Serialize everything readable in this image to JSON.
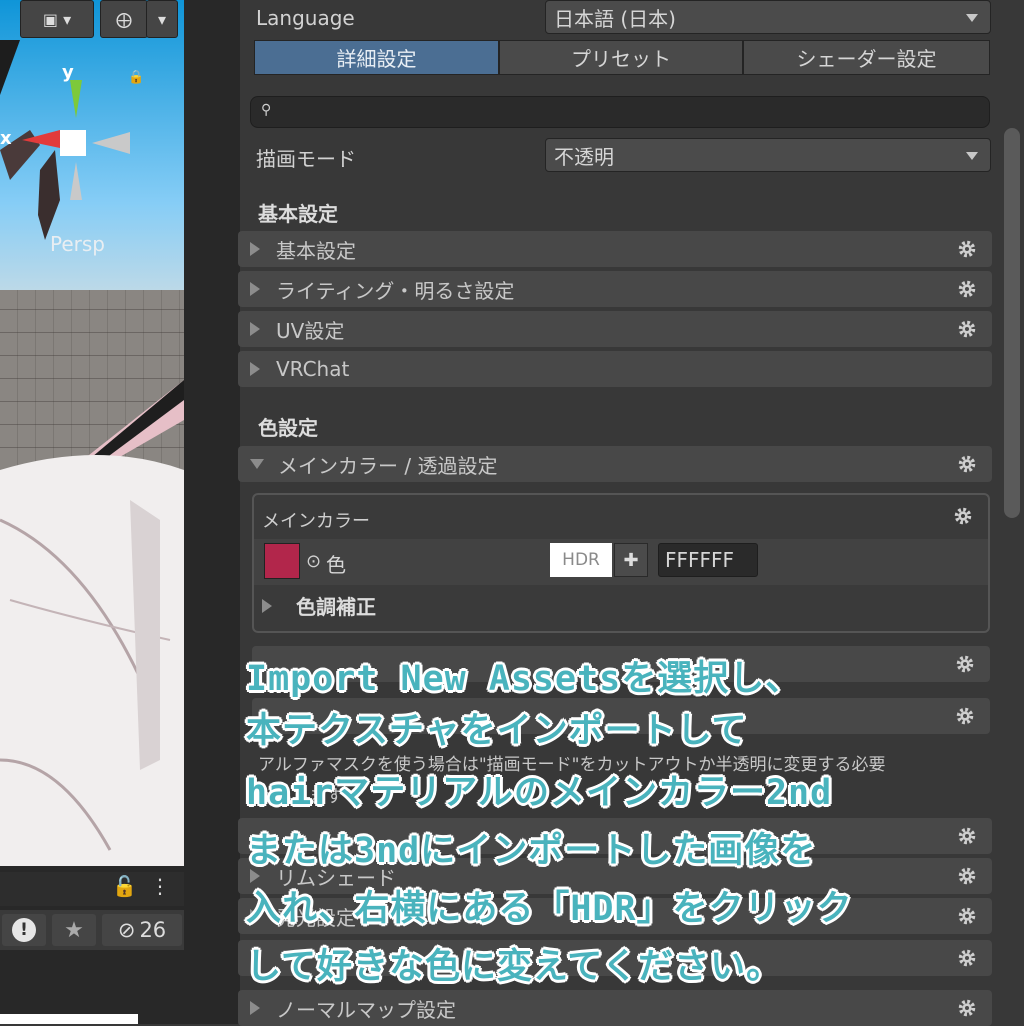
{
  "scene": {
    "gizmo_y": "y",
    "gizmo_x": "x",
    "projection": "Persp",
    "counter": "26"
  },
  "inspector": {
    "language_label": "Language",
    "language_value": "日本語 (日本)",
    "tabs": [
      "詳細設定",
      "プリセット",
      "シェーダー設定"
    ],
    "render_mode_label": "描画モード",
    "render_mode_value": "不透明",
    "basic_section": "基本設定",
    "basic_folds": [
      "基本設定",
      "ライティング・明るさ設定",
      "UV設定",
      "VRChat"
    ],
    "color_section": "色設定",
    "main_color_fold": "メインカラー / 透過設定",
    "main_color_box_title": "メインカラー",
    "color_label": "色",
    "hdr_label": "HDR",
    "hex_value": "FFFFFF",
    "color_adjust_label": "色調補正",
    "partial_help": "アルファマスクを使う場合は\"描画モード\"をカットアウトか半透明に変更する必要",
    "partial_help2": "があります",
    "partial_rim": "リムシェード",
    "partial_light": "発光設定",
    "normal_fold": "ノーマルマップ設定"
  },
  "overlay": {
    "lines": [
      "Import New Assetsを選択し、",
      "本テクスチャをインポートして",
      "hairマテリアルのメインカラー2nd",
      "または3ndにインポートした画像を",
      "入れ、右横にある「HDR」をクリック",
      "して好きな色に変えてください。"
    ]
  },
  "colors": {
    "accent_tab": "#4b6e93",
    "overlay_text": "#49b3bd",
    "swatch": "#b2264b"
  }
}
